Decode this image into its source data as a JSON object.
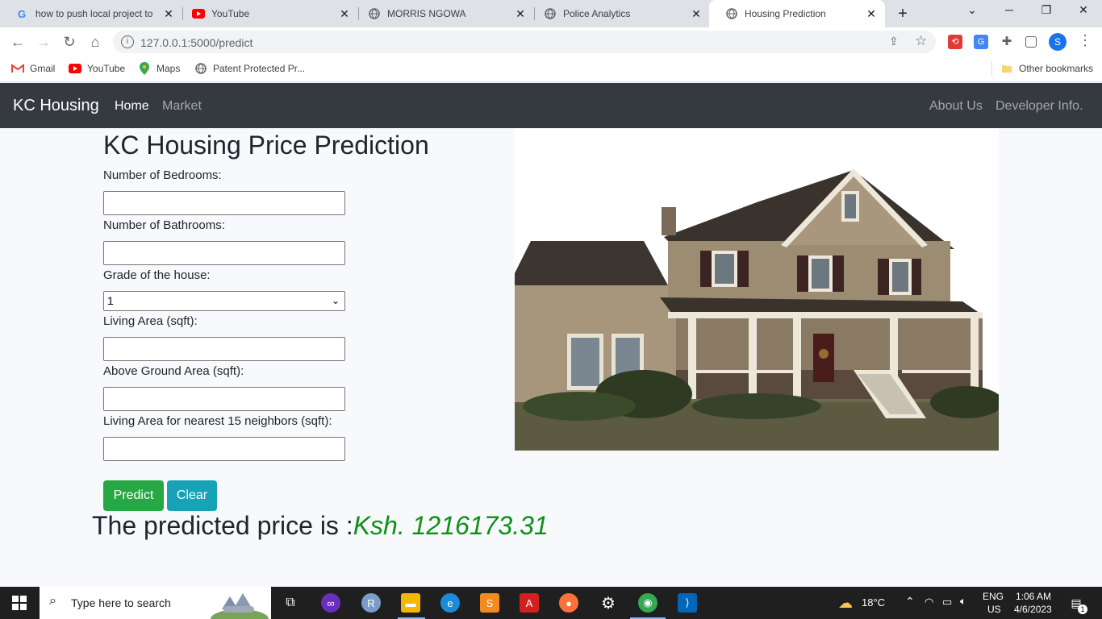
{
  "browser": {
    "tabs": [
      {
        "title": "how to push local project to",
        "icon": "google-icon"
      },
      {
        "title": "YouTube",
        "icon": "youtube-icon"
      },
      {
        "title": "MORRIS NGOWA",
        "icon": "globe-icon"
      },
      {
        "title": "Police Analytics",
        "icon": "globe-icon"
      },
      {
        "title": "Housing Prediction",
        "icon": "globe-icon"
      }
    ],
    "url": "127.0.0.1:5000/predict",
    "profile_initial": "S",
    "bookmarks": [
      {
        "label": "Gmail",
        "icon": "gmail-icon"
      },
      {
        "label": "YouTube",
        "icon": "youtube-icon"
      },
      {
        "label": "Maps",
        "icon": "maps-icon"
      },
      {
        "label": "Patent Protected Pr...",
        "icon": "globe-icon"
      }
    ],
    "other_bookmarks": "Other bookmarks"
  },
  "navbar": {
    "brand": "KC Housing",
    "left_links": [
      "Home",
      "Market"
    ],
    "right_links": [
      "About Us",
      "Developer Info."
    ]
  },
  "form": {
    "title": "KC Housing Price Prediction",
    "bedrooms_label": "Number of Bedrooms:",
    "bathrooms_label": "Number of Bathrooms:",
    "grade_label": "Grade of the house:",
    "grade_value": "1",
    "living_label": "Living Area (sqft):",
    "above_label": "Above Ground Area (sqft):",
    "neighbors_label": "Living Area for nearest 15 neighbors (sqft):",
    "predict_button": "Predict",
    "clear_button": "Clear"
  },
  "result": {
    "prefix": "The predicted price is :",
    "price": "Ksh. 1216173.31"
  },
  "taskbar": {
    "search_placeholder": "Type here to search",
    "temperature": "18°C",
    "language_top": "ENG",
    "language_bottom": "US",
    "time": "1:06 AM",
    "date": "4/6/2023",
    "notification_count": "1"
  },
  "colors": {
    "navbar_bg": "#343a40",
    "predict_btn": "#28a745",
    "clear_btn": "#17a2b8",
    "price_text": "#0f8f17"
  }
}
